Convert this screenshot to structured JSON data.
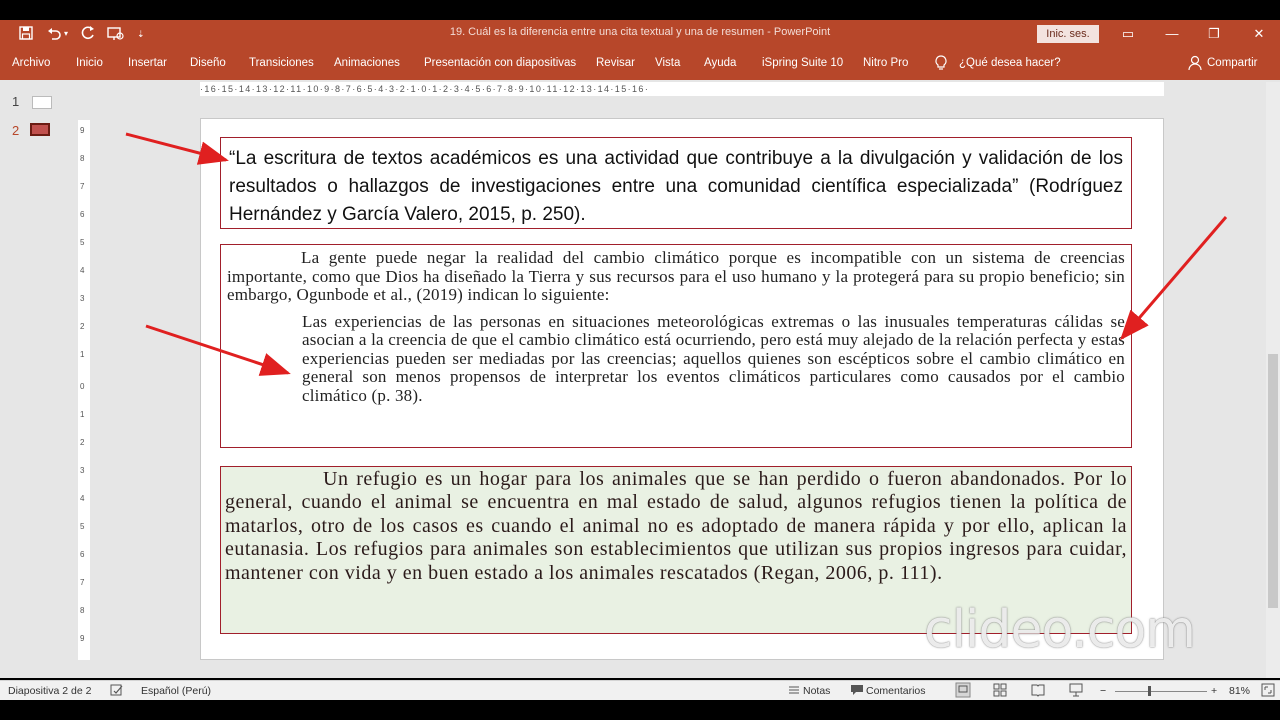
{
  "titlebar": {
    "title": "19. Cuál es la diferencia entre una cita textual y una de resumen  -  PowerPoint",
    "signin_label": "Inic. ses.",
    "qa_save_icon": "save-icon",
    "qa_undo_icon": "undo-icon",
    "qa_redo_icon": "redo-icon",
    "qa_present_icon": "present-icon",
    "qa_customize_icon": "customize-icon"
  },
  "ribbon": {
    "tabs": [
      "Archivo",
      "Inicio",
      "Insertar",
      "Diseño",
      "Transiciones",
      "Animaciones",
      "Presentación con diapositivas",
      "Revisar",
      "Vista",
      "Ayuda",
      "iSpring Suite 10",
      "Nitro Pro"
    ],
    "search_text": "¿Qué desea hacer?",
    "share_label": "Compartir"
  },
  "thumbs": [
    "1",
    "2"
  ],
  "ruler": {
    "h_text": "·16·15·14·13·12·11·10·9·8·7·6·5·4·3·2·1·0·1·2·3·4·5·6·7·8·9·10·11·12·13·14·15·16·",
    "v_marks": [
      "9",
      "8",
      "7",
      "6",
      "5",
      "4",
      "3",
      "2",
      "1",
      "0",
      "1",
      "2",
      "3",
      "4",
      "5",
      "6",
      "7",
      "8",
      "9"
    ]
  },
  "slide": {
    "quote1": "“La escritura de textos académicos es una actividad que contribuye a la divulgación y validación de los resultados o hallazgos de investigaciones entre una comunidad científica especializada” (Rodríguez Hernández y García Valero, 2015, p. 250).",
    "intro": "La gente puede negar la realidad del cambio climático porque es incompatible con un sistema de creencias importante, como que Dios ha diseñado la Tierra y sus recursos para el uso humano y la protegerá para su propio beneficio; sin embargo, Ogunbode et al., (2019) indican lo siguiente:",
    "block_quote": "Las experiencias de las personas en situaciones meteorológicas extremas o las inusuales temperaturas cálidas se asocian a la creencia de que el cambio climático está ocurriendo, pero está muy alejado de la relación perfecta y estas experiencias pueden ser mediadas por las creencias; aquellos quienes son escépticos sobre el cambio climático en general son menos propensos de interpretar los eventos climáticos particulares como causados por el cambio climático  (p. 38).",
    "paragraph3": "Un refugio es un hogar para los animales que se han perdido o fueron abandonados. Por lo general, cuando el animal se encuentra en mal estado de salud, algunos refugios tienen la política de matarlos, otro de los casos es cuando el animal no es adoptado de manera rápida y por ello, aplican la eutanasia. Los refugios para animales son establecimientos que utilizan sus propios ingresos para cuidar, mantener con vida y en buen estado a los animales rescatados (Regan, 2006, p. 111)."
  },
  "watermark": "clideo.com",
  "status": {
    "slide_info": "Diapositiva 2 de 2",
    "language": "Español (Perú)",
    "notes": "Notas",
    "comments": "Comentarios",
    "zoom": "81%"
  },
  "colors": {
    "accent": "#b7472a",
    "box_border": "#a11f2b",
    "arrow": "#e02020",
    "box3_bg": "#e9f1e3"
  }
}
